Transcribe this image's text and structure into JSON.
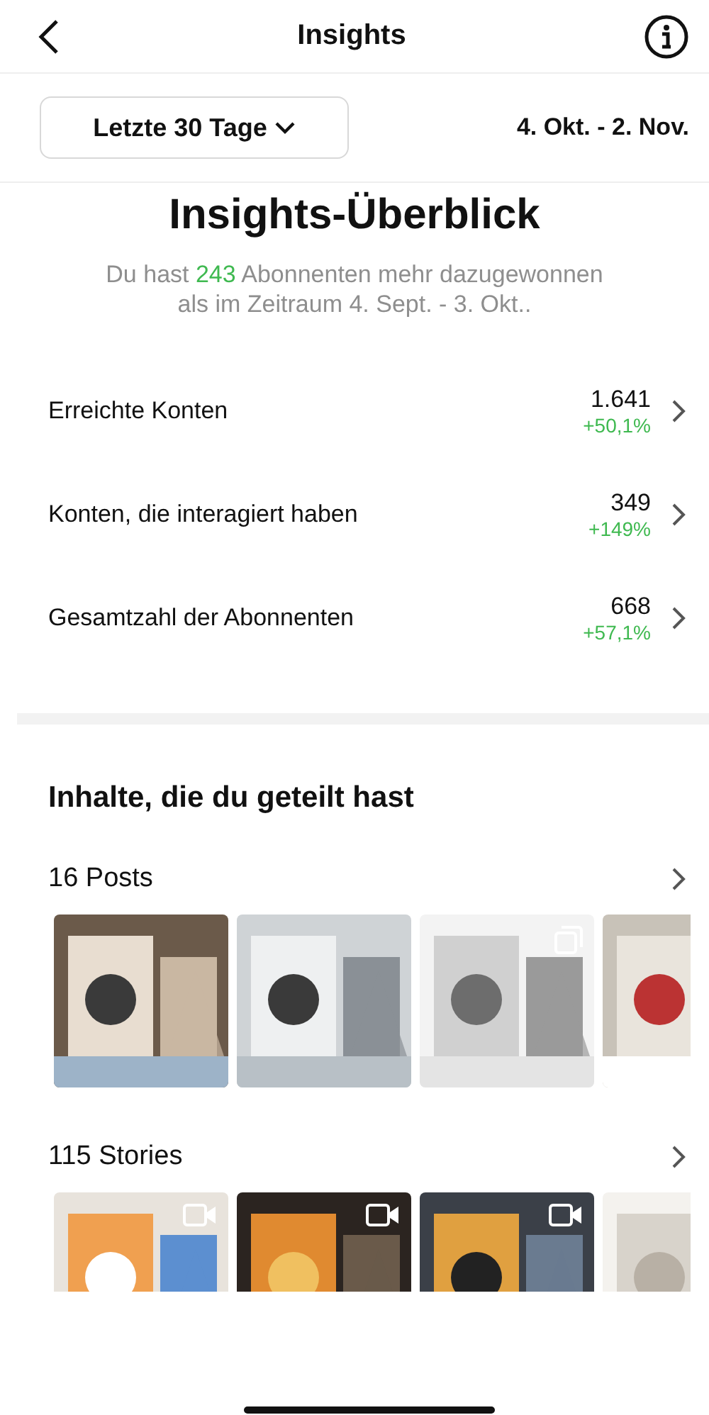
{
  "header": {
    "title": "Insights"
  },
  "period": {
    "label": "Letzte 30 Tage",
    "range": "4. Okt. - 2. Nov."
  },
  "overview": {
    "title": "Insights-Überblick",
    "before": "Du hast ",
    "highlight": "243",
    "after": " Abonnenten mehr dazugewonnen als im Zeitraum 4. Sept. - 3. Okt.."
  },
  "metrics": [
    {
      "label": "Erreichte Konten",
      "value": "1.641",
      "change": "+50,1%"
    },
    {
      "label": "Konten, die interagiert haben",
      "value": "349",
      "change": "+149%"
    },
    {
      "label": "Gesamtzahl der Abonnenten",
      "value": "668",
      "change": "+57,1%"
    }
  ],
  "content": {
    "title": "Inhalte, die du geteilt hast",
    "groups": [
      {
        "label": "16 Posts",
        "items": [
          {
            "kind": "picture",
            "video": false,
            "carousel": false
          },
          {
            "kind": "picture",
            "video": false,
            "carousel": false
          },
          {
            "kind": "picture",
            "video": false,
            "carousel": true
          },
          {
            "kind": "picture",
            "video": false,
            "carousel": false
          }
        ]
      },
      {
        "label": "115 Stories",
        "items": [
          {
            "kind": "picture",
            "video": true,
            "carousel": false
          },
          {
            "kind": "picture",
            "video": true,
            "carousel": false
          },
          {
            "kind": "picture",
            "video": true,
            "carousel": false
          },
          {
            "kind": "picture",
            "video": false,
            "carousel": false
          }
        ]
      }
    ]
  }
}
